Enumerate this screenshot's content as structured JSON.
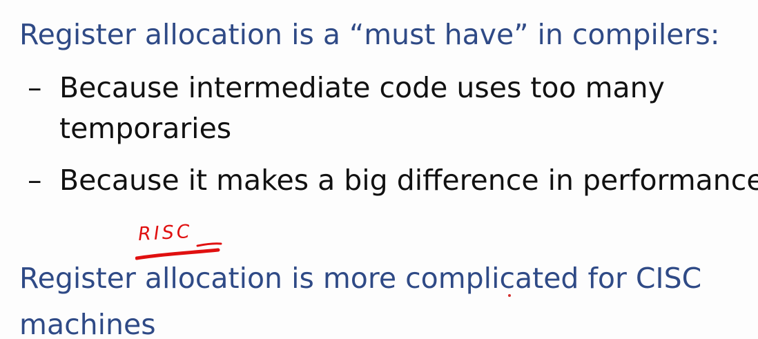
{
  "slide": {
    "heading1": "Register allocation is a “must have” in compilers:",
    "bullet_marker": "–",
    "bullets": [
      {
        "line1": "Because intermediate code uses too many",
        "line2": "temporaries"
      },
      {
        "line1": "Because it makes a big difference in performance"
      }
    ],
    "heading2_line1": "Register allocation is more complicated for CISC",
    "heading2_line2": "machines",
    "annotation": "RISC"
  },
  "colors": {
    "heading": "#2f4a86",
    "body": "#111111",
    "annotation": "#e01010"
  }
}
